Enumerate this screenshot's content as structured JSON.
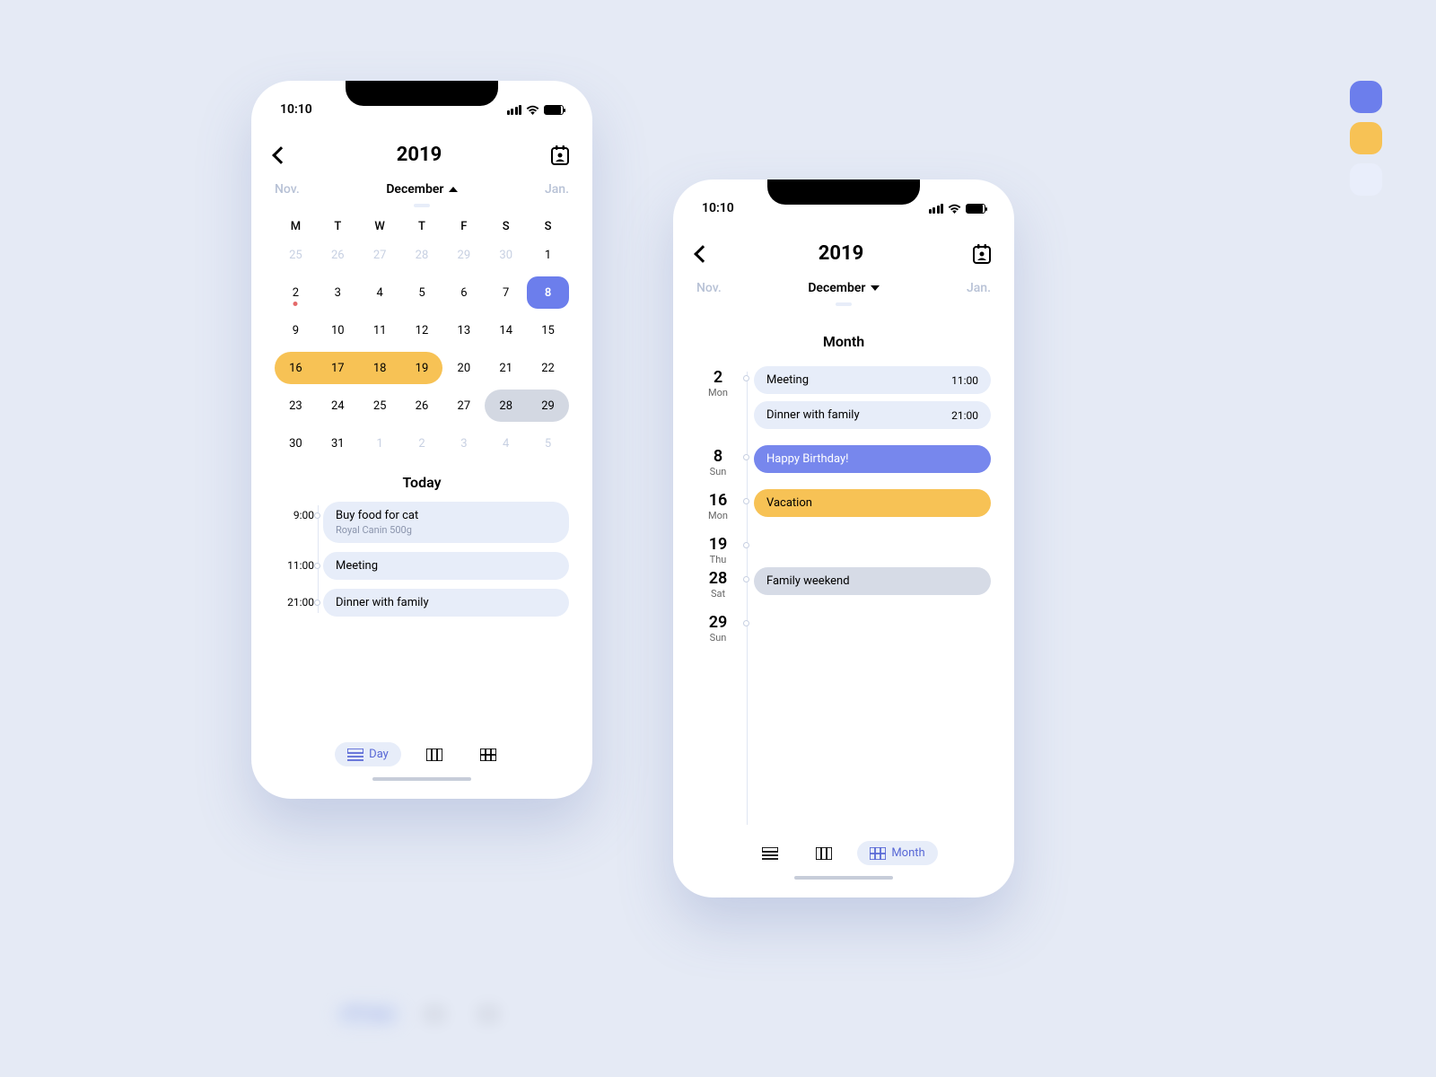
{
  "palette": {
    "primary": "#6c7eec",
    "accent": "#f7c255",
    "light": "#e9eefb"
  },
  "phone1": {
    "status_time": "10:10",
    "year": "2019",
    "prev_month": "Nov.",
    "next_month": "Jan.",
    "current_month": "December",
    "weekdays": [
      "M",
      "T",
      "W",
      "T",
      "F",
      "S",
      "S"
    ],
    "days": [
      {
        "n": "25",
        "faded": true
      },
      {
        "n": "26",
        "faded": true
      },
      {
        "n": "27",
        "faded": true
      },
      {
        "n": "28",
        "faded": true
      },
      {
        "n": "29",
        "faded": true
      },
      {
        "n": "30",
        "faded": true
      },
      {
        "n": "1"
      },
      {
        "n": "2",
        "today": true
      },
      {
        "n": "3"
      },
      {
        "n": "4"
      },
      {
        "n": "5"
      },
      {
        "n": "6"
      },
      {
        "n": "7"
      },
      {
        "n": "8",
        "selected": true
      },
      {
        "n": "9"
      },
      {
        "n": "10"
      },
      {
        "n": "11"
      },
      {
        "n": "12"
      },
      {
        "n": "13"
      },
      {
        "n": "14"
      },
      {
        "n": "15"
      },
      {
        "n": "16",
        "yellow": "start"
      },
      {
        "n": "17",
        "yellow": "mid"
      },
      {
        "n": "18",
        "yellow": "mid"
      },
      {
        "n": "19",
        "yellow": "end"
      },
      {
        "n": "20"
      },
      {
        "n": "21"
      },
      {
        "n": "22"
      },
      {
        "n": "23"
      },
      {
        "n": "24"
      },
      {
        "n": "25"
      },
      {
        "n": "26"
      },
      {
        "n": "27"
      },
      {
        "n": "28",
        "grey": "start"
      },
      {
        "n": "29",
        "grey": "end"
      },
      {
        "n": "30"
      },
      {
        "n": "31"
      },
      {
        "n": "1",
        "faded": true
      },
      {
        "n": "2",
        "faded": true
      },
      {
        "n": "3",
        "faded": true
      },
      {
        "n": "4",
        "faded": true
      },
      {
        "n": "5",
        "faded": true
      }
    ],
    "today_label": "Today",
    "agenda": [
      {
        "time": "9:00",
        "title": "Buy food for cat",
        "sub": "Royal Canin 500g"
      },
      {
        "time": "11:00",
        "title": "Meeting"
      },
      {
        "time": "21:00",
        "title": "Dinner with family"
      }
    ],
    "views": {
      "day": "Day"
    }
  },
  "phone2": {
    "status_time": "10:10",
    "year": "2019",
    "prev_month": "Nov.",
    "next_month": "Jan.",
    "current_month": "December",
    "section_label": "Month",
    "entries": [
      {
        "day": "2",
        "dow": "Mon",
        "pills": [
          {
            "title": "Meeting",
            "time": "11:00",
            "style": "light"
          },
          {
            "title": "Dinner with family",
            "time": "21:00",
            "style": "light"
          }
        ]
      },
      {
        "day": "8",
        "dow": "Sun",
        "pills": [
          {
            "title": "Happy Birthday!",
            "style": "purple"
          }
        ]
      },
      {
        "day": "16",
        "dow": "Mon",
        "pills": [
          {
            "title": "Vacation",
            "style": "yellow"
          }
        ]
      },
      {
        "day": "19",
        "dow": "Thu",
        "pills": []
      },
      {
        "day": "28",
        "dow": "Sat",
        "pills": [
          {
            "title": "Family weekend",
            "style": "grey"
          }
        ]
      },
      {
        "day": "29",
        "dow": "Sun",
        "pills": []
      }
    ],
    "views": {
      "month": "Month"
    }
  }
}
